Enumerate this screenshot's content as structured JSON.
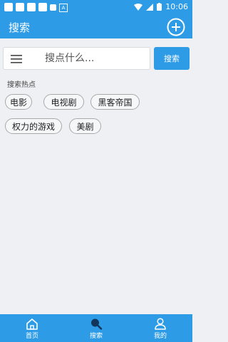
{
  "statusbar": {
    "time": "10:06"
  },
  "appbar": {
    "title": "搜索"
  },
  "search": {
    "placeholder": "搜点什么...",
    "button_label": "搜索"
  },
  "hot": {
    "title": "搜索热点",
    "tags": [
      "电影",
      "电视剧",
      "黑客帝国",
      "权力的游戏",
      "美剧"
    ]
  },
  "nav": {
    "items": [
      {
        "label": "首页",
        "icon": "home-icon"
      },
      {
        "label": "搜索",
        "icon": "search-icon"
      },
      {
        "label": "我的",
        "icon": "user-icon"
      }
    ]
  },
  "colors": {
    "primary": "#2d9be6",
    "background": "#eef0f4",
    "tag_border": "#a9a9a9"
  }
}
